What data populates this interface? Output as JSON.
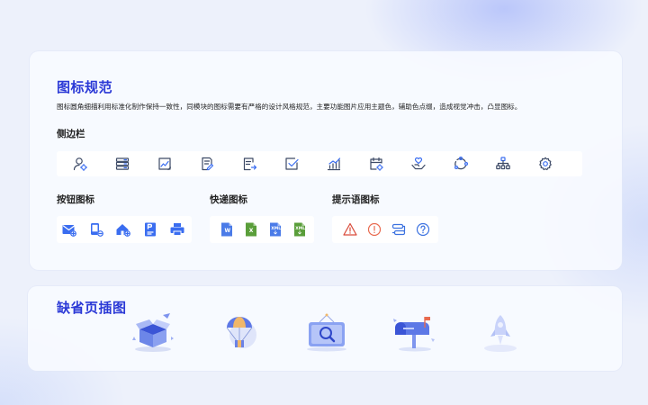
{
  "icon_spec": {
    "title": "图标规范",
    "description": "图标圆角细描利用标准化制作保持一致性，同模块的图标需要有严格的设计风格规范，主要功能图片应用主题色，辅助色点缀，造成视觉冲击，凸显图标。",
    "sidebar": {
      "title": "侧边栏",
      "icons": [
        "user-settings-icon",
        "server-list-icon",
        "chart-document-icon",
        "document-edit-icon",
        "document-export-icon",
        "checkbox-icon",
        "bar-chart-icon",
        "calendar-settings-icon",
        "hand-care-icon",
        "refresh-cycle-icon",
        "org-chart-icon",
        "gear-icon"
      ]
    },
    "button_icons": {
      "title": "按钮图标",
      "icons": [
        "mail-add-icon",
        "device-remove-icon",
        "house-add-icon",
        "parking-card-icon",
        "printer-icon"
      ]
    },
    "express_icons": {
      "title": "快递图标",
      "icons": [
        "word-file-icon",
        "excel-file-icon",
        "xml-file-blue-icon",
        "xml-file-green-icon"
      ],
      "badges": [
        "W",
        "X",
        "XML",
        "XML"
      ]
    },
    "hint_icons": {
      "title": "提示语图标",
      "icons": [
        "warning-triangle-icon",
        "error-circle-icon",
        "route-icon",
        "help-circle-icon"
      ]
    }
  },
  "empty_state": {
    "title": "缺省页插图",
    "illustrations": [
      "open-box-illustration",
      "parachute-box-illustration",
      "search-board-illustration",
      "mailbox-illustration",
      "rocket-illustration"
    ]
  },
  "colors": {
    "title": "#2b39d6",
    "accent": "#3a6df0",
    "icon_stroke": "#3d4a66",
    "warning": "#e86a4f"
  }
}
